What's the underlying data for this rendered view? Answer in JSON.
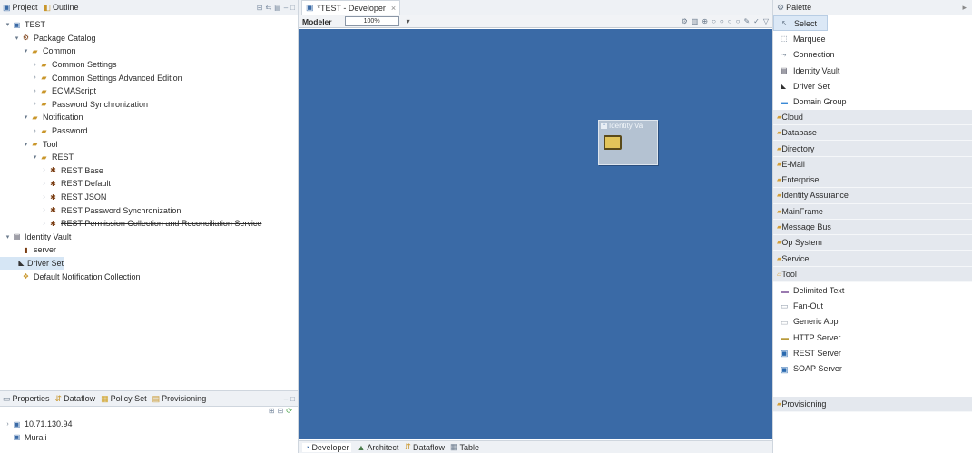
{
  "left_tabs": {
    "project": "Project",
    "outline": "Outline"
  },
  "tree": [
    {
      "indent": 0,
      "tw": "v",
      "icon": "project-icon",
      "label": "TEST"
    },
    {
      "indent": 1,
      "tw": "v",
      "icon": "package-catalog-icon",
      "label": "Package Catalog"
    },
    {
      "indent": 2,
      "tw": "v",
      "icon": "folder-icon",
      "label": "Common"
    },
    {
      "indent": 3,
      "tw": ">",
      "icon": "folder-icon",
      "label": "Common Settings"
    },
    {
      "indent": 3,
      "tw": ">",
      "icon": "folder-icon",
      "label": "Common Settings Advanced Edition"
    },
    {
      "indent": 3,
      "tw": ">",
      "icon": "folder-icon",
      "label": "ECMAScript"
    },
    {
      "indent": 3,
      "tw": ">",
      "icon": "folder-icon",
      "label": "Password Synchronization"
    },
    {
      "indent": 2,
      "tw": "v",
      "icon": "folder-icon",
      "label": "Notification"
    },
    {
      "indent": 3,
      "tw": ">",
      "icon": "folder-icon",
      "label": "Password"
    },
    {
      "indent": 2,
      "tw": "v",
      "icon": "folder-icon",
      "label": "Tool"
    },
    {
      "indent": 3,
      "tw": "v",
      "icon": "folder-icon",
      "label": "REST"
    },
    {
      "indent": 4,
      "tw": ">",
      "icon": "plug-icon",
      "label": "REST Base"
    },
    {
      "indent": 4,
      "tw": ">",
      "icon": "plug-icon",
      "label": "REST Default"
    },
    {
      "indent": 4,
      "tw": ">",
      "icon": "plug-icon",
      "label": "REST JSON"
    },
    {
      "indent": 4,
      "tw": ">",
      "icon": "plug-icon",
      "label": "REST Password Synchronization"
    },
    {
      "indent": 4,
      "tw": ">",
      "icon": "plug-icon",
      "label": "REST Permission Collection and Reconciliation Service",
      "strike": true
    },
    {
      "indent": 0,
      "tw": "v",
      "icon": "identity-vault-icon",
      "label": "Identity Vault"
    },
    {
      "indent": 1,
      "tw": "",
      "icon": "server-icon",
      "label": "server"
    },
    {
      "indent": 1,
      "tw": "",
      "icon": "driver-set-icon",
      "label": "Driver Set",
      "selected": true
    },
    {
      "indent": 1,
      "tw": "",
      "icon": "notification-collection-icon",
      "label": "Default Notification Collection"
    }
  ],
  "bottom_tabs": {
    "properties": "Properties",
    "dataflow": "Dataflow",
    "policy_set": "Policy Set",
    "provisioning": "Provisioning"
  },
  "bottom_tree": [
    {
      "tw": ">",
      "label": "10.71.130.94"
    },
    {
      "tw": "",
      "label": "Murali"
    }
  ],
  "editor": {
    "tab_title": "*TEST - Developer",
    "modeler_label": "Modeler",
    "zoom": "100%",
    "node_label": "Identity Va",
    "bottom_tabs": {
      "developer": "Developer",
      "architect": "Architect",
      "dataflow": "Dataflow",
      "table": "Table"
    }
  },
  "palette": {
    "title": "Palette",
    "tools": [
      "Select",
      "Marquee",
      "Connection",
      "Identity Vault",
      "Driver Set",
      "Domain Group"
    ],
    "drawers_top": [
      "Cloud",
      "Database",
      "Directory",
      "E-Mail",
      "Enterprise",
      "Identity Assurance",
      "MainFrame",
      "Message Bus",
      "Op System",
      "Service",
      "Tool"
    ],
    "tool_items": [
      "Delimited Text",
      "Fan-Out",
      "Generic App",
      "HTTP Server",
      "REST Server",
      "SOAP Server"
    ],
    "drawer_bottom": "Provisioning"
  },
  "colors": {
    "canvas": "#3a6aa6",
    "selection": "#d6e6f5"
  }
}
